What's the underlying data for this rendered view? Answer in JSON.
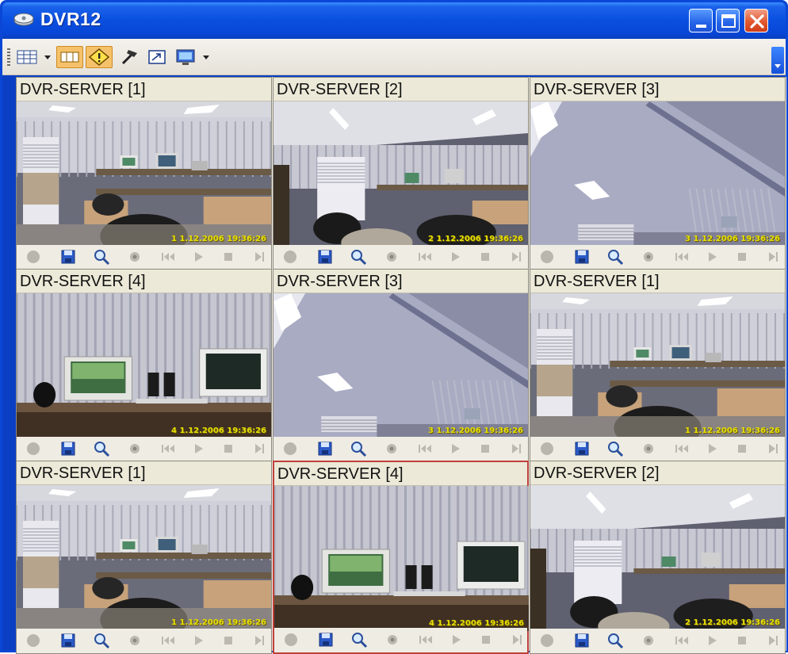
{
  "window": {
    "title": "DVR12",
    "icon": "dvr-app-icon",
    "buttons": [
      "minimize-icon",
      "maximize-icon",
      "close-icon"
    ]
  },
  "toolbar": {
    "items": [
      "layout-grid-icon",
      "dropdown-arrow-icon",
      "display-split-icon",
      "alarm-warning-icon",
      "tools-hammer-icon",
      "fullscreen-icon",
      "monitor-icon",
      "dropdown-arrow-icon"
    ]
  },
  "channels": [
    {
      "title": "DVR-SERVER [1]",
      "stamp": "1  1.12.2006 19:36:26",
      "scene": "office"
    },
    {
      "title": "DVR-SERVER [2]",
      "stamp": "2  1.12.2006 19:36:26",
      "scene": "office-wide"
    },
    {
      "title": "DVR-SERVER [3]",
      "stamp": "3  1.12.2006 19:36:26",
      "scene": "ceiling"
    },
    {
      "title": "DVR-SERVER [4]",
      "stamp": "4  1.12.2006 19:36:26",
      "scene": "monitors"
    },
    {
      "title": "DVR-SERVER [3]",
      "stamp": "3  1.12.2006 19:36:26",
      "scene": "ceiling"
    },
    {
      "title": "DVR-SERVER [1]",
      "stamp": "1  1.12.2006 19:36:26",
      "scene": "office"
    },
    {
      "title": "DVR-SERVER [1]",
      "stamp": "1  1.12.2006 19:36:26",
      "scene": "office"
    },
    {
      "title": "DVR-SERVER [4]",
      "stamp": "4  1.12.2006 19:36:26",
      "scene": "monitors"
    },
    {
      "title": "DVR-SERVER [2]",
      "stamp": "2  1.12.2006 19:36:26",
      "scene": "office-wide"
    }
  ],
  "selected_channel_index": 7,
  "channel_controls": [
    "record-icon",
    "save-icon",
    "search-icon",
    "snapshot-icon",
    "rewind-icon",
    "play-icon",
    "stop-icon",
    "step-forward-icon"
  ],
  "colors": {
    "titlebar": "#0a4fe0",
    "selected_border": "#c0403a",
    "timestamp": "#e7e000"
  }
}
